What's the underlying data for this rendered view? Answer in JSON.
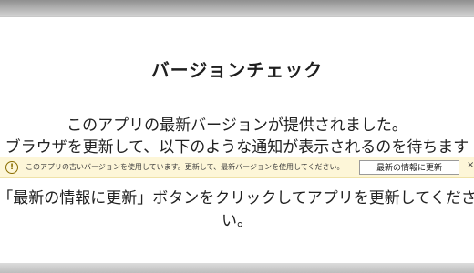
{
  "dialog": {
    "title": "バージョンチェック",
    "line1": "このアプリの最新バージョンが提供されました。",
    "line2": "ブラウザを更新して、以下のような通知が表示されるのを待ちます",
    "line3": "「最新の情報に更新」ボタンをクリックしてアプリを更新してくださ",
    "line4": "い。"
  },
  "notification": {
    "icon": "info-icon",
    "icon_glyph": "!",
    "text": "このアプリの古いバージョンを使用しています。更新して、最新バージョンを使用してください。",
    "button_label": "最新の情報に更新",
    "close_glyph": "×"
  }
}
